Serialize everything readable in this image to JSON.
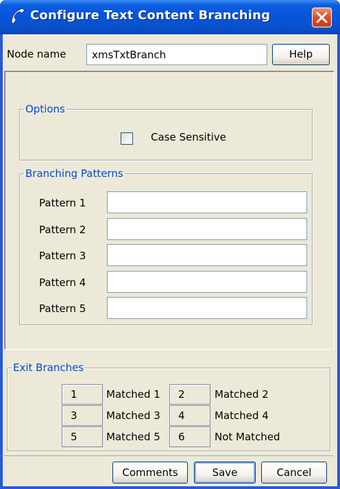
{
  "window": {
    "title": "Configure Text Content Branching",
    "icon": "handset-icon",
    "close_icon": "close-x-icon",
    "accent_color": "#0a5de0",
    "close_color": "#d8502a"
  },
  "node": {
    "label": "Node name",
    "value": "xmsTxtBranch",
    "help_label": "Help"
  },
  "options": {
    "legend": "Options",
    "case_sensitive_label": "Case Sensitive",
    "case_sensitive_checked": false
  },
  "branching": {
    "legend": "Branching Patterns",
    "patterns": [
      {
        "label": "Pattern 1",
        "value": ""
      },
      {
        "label": "Pattern 2",
        "value": ""
      },
      {
        "label": "Pattern 3",
        "value": ""
      },
      {
        "label": "Pattern 4",
        "value": ""
      },
      {
        "label": "Pattern 5",
        "value": ""
      }
    ]
  },
  "exits": {
    "legend": "Exit Branches",
    "branches": [
      {
        "num": "1",
        "label": "Matched 1"
      },
      {
        "num": "2",
        "label": "Matched 2"
      },
      {
        "num": "3",
        "label": "Matched 3"
      },
      {
        "num": "4",
        "label": "Matched 4"
      },
      {
        "num": "5",
        "label": "Matched 5"
      },
      {
        "num": "6",
        "label": "Not Matched"
      }
    ]
  },
  "footer": {
    "comments_label": "Comments",
    "save_label": "Save",
    "cancel_label": "Cancel"
  }
}
